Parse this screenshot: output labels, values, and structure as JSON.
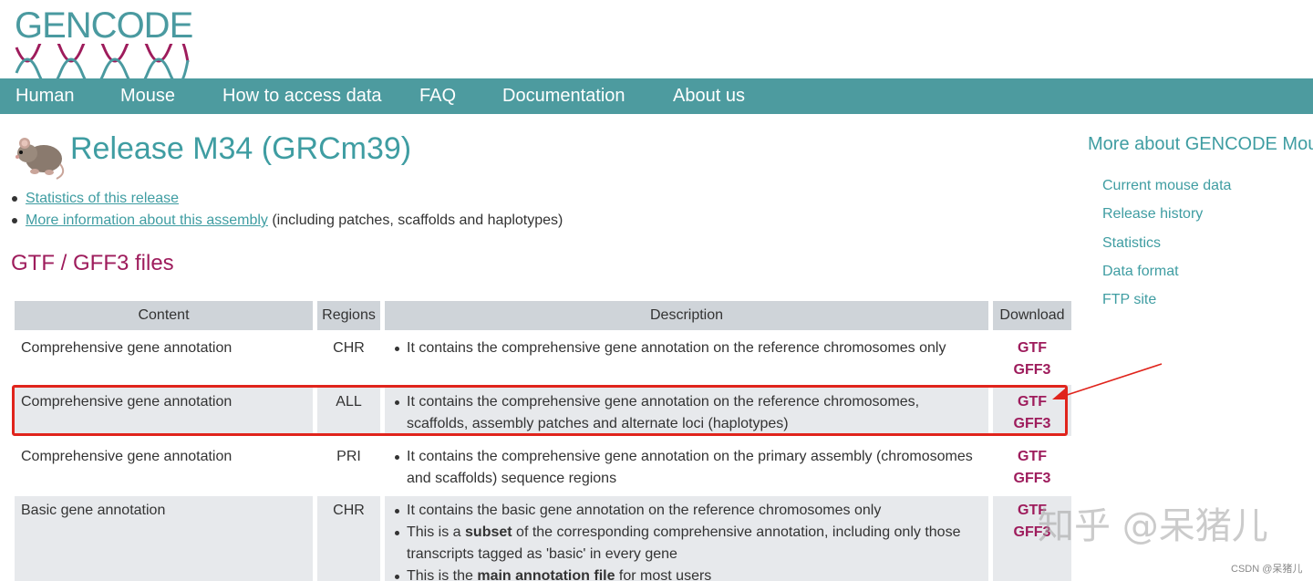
{
  "logo": {
    "text": "GENCODE"
  },
  "nav": [
    "Human",
    "Mouse",
    "How to access data",
    "FAQ",
    "Documentation",
    "About us"
  ],
  "release": {
    "title": "Release M34 (GRCm39)"
  },
  "links": {
    "stats": "Statistics of this release",
    "assembly": "More information about this assembly",
    "assembly_suffix": " (including patches, scaffolds and haplotypes)"
  },
  "section_title": "GTF / GFF3 files",
  "table": {
    "headers": [
      "Content",
      "Regions",
      "Description",
      "Download"
    ],
    "rows": [
      {
        "content": "Comprehensive gene annotation",
        "region": "CHR",
        "desc": [
          "It contains the comprehensive gene annotation on the reference chromosomes only"
        ],
        "downloads": [
          "GTF",
          "GFF3"
        ]
      },
      {
        "content": "Comprehensive gene annotation",
        "region": "ALL",
        "desc": [
          "It contains the comprehensive gene annotation on the reference chromosomes, scaffolds, assembly patches and alternate loci (haplotypes)"
        ],
        "downloads": [
          "GTF",
          "GFF3"
        ]
      },
      {
        "content": "Comprehensive gene annotation",
        "region": "PRI",
        "desc": [
          "It contains the comprehensive gene annotation on the primary assembly (chromosomes and scaffolds) sequence regions"
        ],
        "downloads": [
          "GTF",
          "GFF3"
        ]
      },
      {
        "content": "Basic gene annotation",
        "region": "CHR",
        "desc_b1": "It contains the basic gene annotation on the reference chromosomes only",
        "desc_b2_pre": "This is a ",
        "desc_b2_bold": "subset",
        "desc_b2_post": " of the corresponding comprehensive annotation, including only those transcripts tagged as 'basic' in every gene",
        "desc_b3_pre": "This is the ",
        "desc_b3_bold": "main annotation file",
        "desc_b3_post": " for most users",
        "downloads": [
          "GTF",
          "GFF3"
        ]
      }
    ]
  },
  "sidebar": {
    "title": "More about GENCODE Mouse",
    "items": [
      "Current mouse data",
      "Release history",
      "Statistics",
      "Data format",
      "FTP site"
    ]
  },
  "watermark": {
    "main": "知乎 @呆猪儿",
    "small": "CSDN @呆猪儿"
  },
  "colors": {
    "teal": "#4d9b9f",
    "link_teal": "#3f9da2",
    "maroon": "#9e1c5c",
    "highlight_red": "#e0241c"
  }
}
